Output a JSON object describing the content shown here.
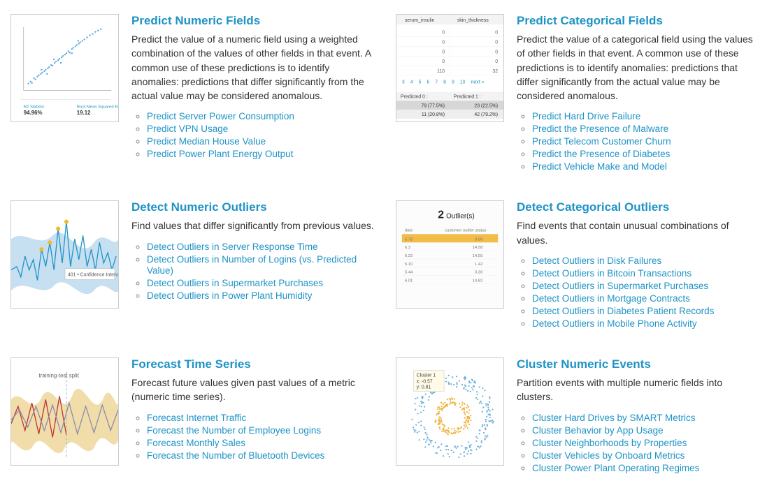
{
  "cards": [
    {
      "id": "predict-numeric",
      "title": "Predict Numeric Fields",
      "desc": "Predict the value of a numeric field using a weighted combination of the values of other fields in that event. A common use of these predictions is to identify anomalies: predictions that differ significantly from the actual value may be considered anomalous.",
      "links": [
        "Predict Server Power Consumption",
        "Predict VPN Usage",
        "Predict Median House Value",
        "Predict Power Plant Energy Output"
      ]
    },
    {
      "id": "predict-categorical",
      "title": "Predict Categorical Fields",
      "desc": "Predict the value of a categorical field using the values of other fields in that event. A common use of these predictions is to identify anomalies: predictions that differ significantly from the actual value may be considered anomalous.",
      "links": [
        "Predict Hard Drive Failure",
        "Predict the Presence of Malware",
        "Predict Telecom Customer Churn",
        "Predict the Presence of Diabetes",
        "Predict Vehicle Make and Model"
      ]
    },
    {
      "id": "detect-numeric",
      "title": "Detect Numeric Outliers",
      "desc": "Find values that differ significantly from previous values.",
      "links": [
        "Detect Outliers in Server Response Time",
        "Detect Outliers in Number of Logins (vs. Predicted Value)",
        "Detect Outliers in Supermarket Purchases",
        "Detect Outliers in Power Plant Humidity"
      ]
    },
    {
      "id": "detect-categorical",
      "title": "Detect Categorical Outliers",
      "desc": "Find events that contain unusual combinations of values.",
      "links": [
        "Detect Outliers in Disk Failures",
        "Detect Outliers in Bitcoin Transactions",
        "Detect Outliers in Supermarket Purchases",
        "Detect Outliers in Mortgage Contracts",
        "Detect Outliers in Diabetes Patient Records",
        "Detect Outliers in Mobile Phone Activity"
      ]
    },
    {
      "id": "forecast",
      "title": "Forecast Time Series",
      "desc": "Forecast future values given past values of a metric (numeric time series).",
      "links": [
        "Forecast Internet Traffic",
        "Forecast the Number of Employee Logins",
        "Forecast Monthly Sales",
        "Forecast the Number of Bluetooth Devices"
      ]
    },
    {
      "id": "cluster",
      "title": "Cluster Numeric Events",
      "desc": "Partition events with multiple numeric fields into clusters.",
      "links": [
        "Cluster Hard Drives by SMART Metrics",
        "Cluster Behavior by App Usage",
        "Cluster Neighborhoods by Properties",
        "Cluster Vehicles by Onboard Metrics",
        "Cluster Power Plant Operating Regimes"
      ]
    }
  ],
  "thumb_labels": {
    "predict_numeric_stat1": "94.96%",
    "predict_numeric_stat2": "19.12",
    "predict_categorical_hdr1": "serum_insulin",
    "predict_categorical_hdr2": "skin_thickness",
    "predict_categorical_pred0": "Predicted 0 :",
    "predict_categorical_pred1": "Predicted 1 :",
    "predict_categorical_row_a1": "79 (77.5%)",
    "predict_categorical_row_a2": "23 (22.5%)",
    "predict_categorical_row_b1": "11 (20.8%)",
    "predict_categorical_row_b2": "42 (79.2%)",
    "predict_categorical_pager_next": "next »",
    "detect_numeric_tooltip": "401 • Confidence Interv",
    "detect_categorical_banner": "Outlier(s)",
    "detect_categorical_banner_num": "2",
    "forecast_split": "training-test split",
    "cluster_label": "Cluster 1",
    "cluster_x": "x: -0.57",
    "cluster_y": "y: 0.81"
  }
}
